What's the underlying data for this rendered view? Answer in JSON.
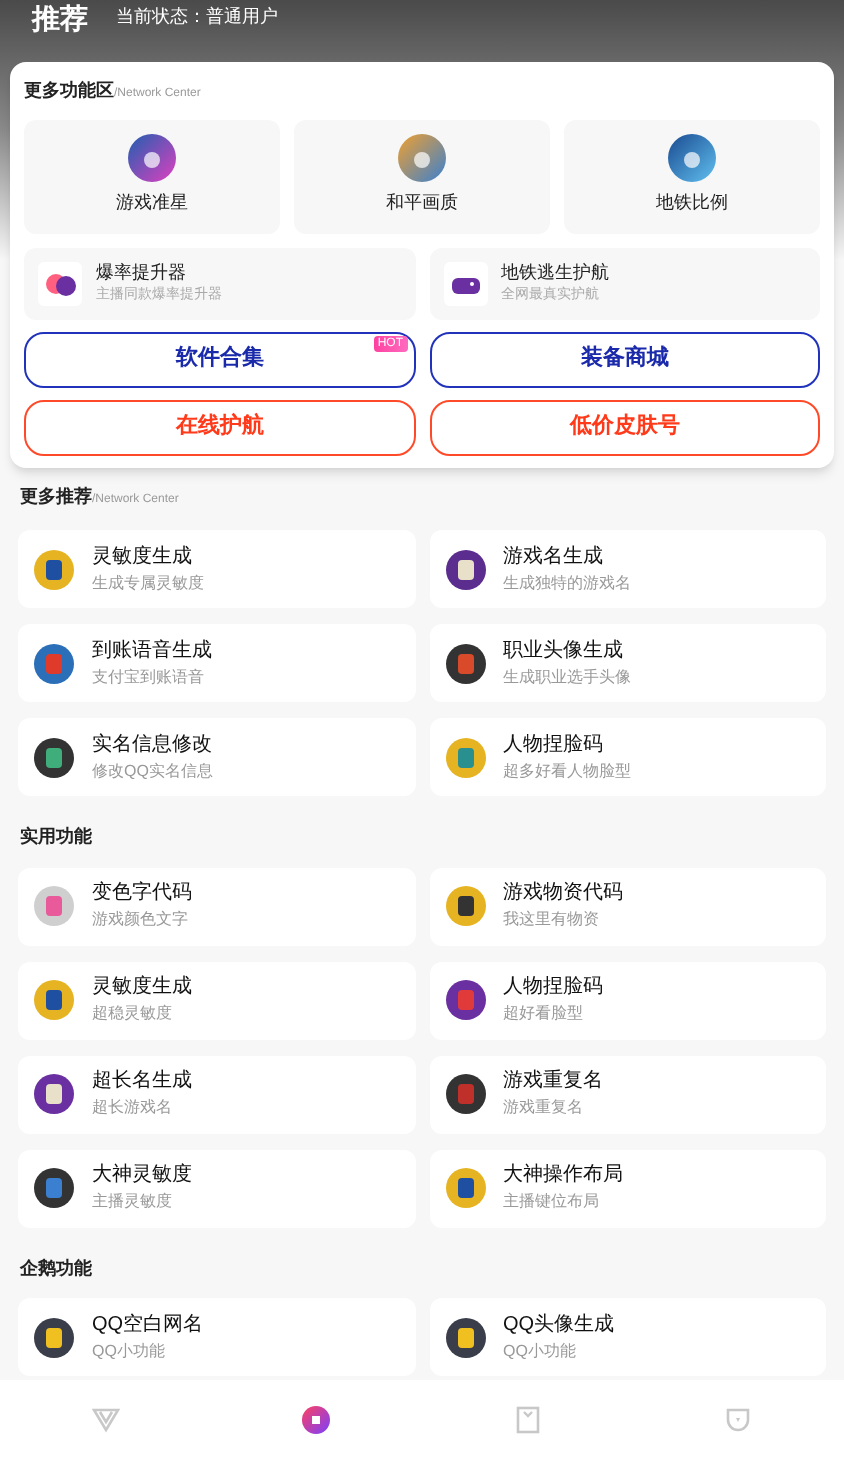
{
  "header": {
    "title": "推荐",
    "status": "当前状态：普通用户"
  },
  "feature_panel": {
    "title": "更多功能区",
    "subtitle": "/Network Center",
    "tiles": [
      {
        "label": "游戏准星"
      },
      {
        "label": "和平画质"
      },
      {
        "label": "地铁比例"
      }
    ],
    "wide_tiles": [
      {
        "title": "爆率提升器",
        "subtitle": "主播同款爆率提升器"
      },
      {
        "title": "地铁逃生护航",
        "subtitle": "全网最真实护航"
      }
    ],
    "buttons": [
      {
        "label": "软件合集",
        "kind": "primary",
        "badge": "HOT"
      },
      {
        "label": "装备商城",
        "kind": "primary"
      },
      {
        "label": "在线护航",
        "kind": "accent"
      },
      {
        "label": "低价皮肤号",
        "kind": "accent"
      }
    ]
  },
  "sections": [
    {
      "title": "更多推荐",
      "subtitle": "/Network Center",
      "items": [
        {
          "title": "灵敏度生成",
          "subtitle": "生成专属灵敏度"
        },
        {
          "title": "游戏名生成",
          "subtitle": "生成独特的游戏名"
        },
        {
          "title": "到账语音生成",
          "subtitle": "支付宝到账语音"
        },
        {
          "title": "职业头像生成",
          "subtitle": "生成职业选手头像"
        },
        {
          "title": "实名信息修改",
          "subtitle": "修改QQ实名信息"
        },
        {
          "title": "人物捏脸码",
          "subtitle": "超多好看人物脸型"
        }
      ]
    },
    {
      "title": "实用功能",
      "items": [
        {
          "title": "变色字代码",
          "subtitle": "游戏颜色文字"
        },
        {
          "title": "游戏物资代码",
          "subtitle": "我这里有物资"
        },
        {
          "title": "灵敏度生成",
          "subtitle": "超稳灵敏度"
        },
        {
          "title": "人物捏脸码",
          "subtitle": "超好看脸型"
        },
        {
          "title": "超长名生成",
          "subtitle": "超长游戏名"
        },
        {
          "title": "游戏重复名",
          "subtitle": "游戏重复名"
        },
        {
          "title": "大神灵敏度",
          "subtitle": "主播灵敏度"
        },
        {
          "title": "大神操作布局",
          "subtitle": "主播键位布局"
        }
      ]
    },
    {
      "title": "企鹅功能",
      "items": [
        {
          "title": "QQ空白网名",
          "subtitle": "QQ小功能"
        },
        {
          "title": "QQ头像生成",
          "subtitle": "QQ小功能"
        }
      ]
    }
  ],
  "tab_bar": [
    {
      "selected": false
    },
    {
      "selected": true
    },
    {
      "selected": false
    },
    {
      "selected": false
    }
  ]
}
